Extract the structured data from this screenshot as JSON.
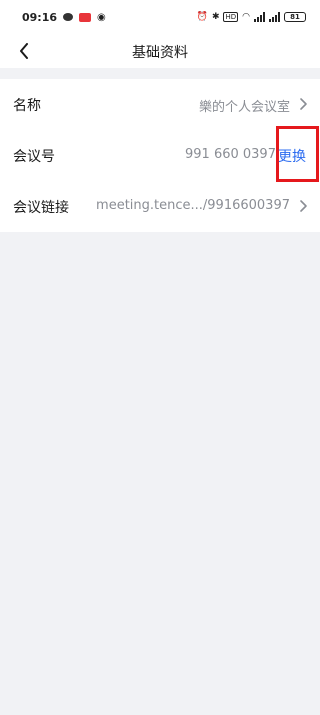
{
  "status_bar": {
    "time": "09:16",
    "network": "HD",
    "battery": "81"
  },
  "header": {
    "title": "基础资料"
  },
  "rows": [
    {
      "label": "名称",
      "value": "樂的个人会议室"
    },
    {
      "label": "会议号",
      "value": "991 660 0397",
      "action": "更换"
    },
    {
      "label": "会议链接",
      "value": "meeting.tence.../9916600397"
    }
  ],
  "colors": {
    "accent": "#2c6cf0",
    "highlight_border": "#e5181c",
    "secondary_text": "#8a8d94",
    "page_bg": "#f1f2f5"
  }
}
